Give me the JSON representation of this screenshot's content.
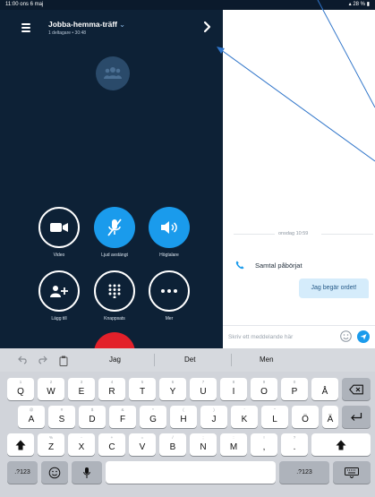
{
  "status_bar": {
    "time_date": "11:00  ons 6 maj",
    "battery": "28 %"
  },
  "call": {
    "title": "Jobba-hemma-träff",
    "title_chevron": "⌄",
    "subtitle": "1 deltagare • 30:48",
    "controls": [
      {
        "id": "video",
        "label": "Video",
        "icon": "video-camera-icon",
        "style": "outline"
      },
      {
        "id": "mute",
        "label": "Ljud avstängt",
        "icon": "microphone-off-icon",
        "style": "blue"
      },
      {
        "id": "speaker",
        "label": "Högtalare",
        "icon": "speaker-icon",
        "style": "blue"
      },
      {
        "id": "add",
        "label": "Lägg till",
        "icon": "add-person-icon",
        "style": "outline"
      },
      {
        "id": "dialpad",
        "label": "Knappsats",
        "icon": "dialpad-icon",
        "style": "outline"
      },
      {
        "id": "more",
        "label": "Mer",
        "icon": "more-icon",
        "style": "outline"
      }
    ]
  },
  "chat": {
    "date": "onsdag 10:59",
    "call_started": "Samtal påbörjat",
    "message": "Jag begär ordet!",
    "compose_placeholder": "Skriv ett meddelande här"
  },
  "keyboard": {
    "suggestions": [
      "Jag",
      "Det",
      "Men"
    ],
    "row1": [
      [
        "Q",
        "1"
      ],
      [
        "W",
        "2"
      ],
      [
        "E",
        "3"
      ],
      [
        "R",
        "4"
      ],
      [
        "T",
        "5"
      ],
      [
        "Y",
        "6"
      ],
      [
        "U",
        "7"
      ],
      [
        "I",
        "8"
      ],
      [
        "O",
        "9"
      ],
      [
        "P",
        "0"
      ],
      [
        "Å",
        ""
      ]
    ],
    "row2": [
      [
        "A",
        "@"
      ],
      [
        "S",
        "#"
      ],
      [
        "D",
        "$"
      ],
      [
        "F",
        "&"
      ],
      [
        "G",
        "*"
      ],
      [
        "H",
        "("
      ],
      [
        "J",
        ")"
      ],
      [
        "K",
        "'"
      ],
      [
        "L",
        "\""
      ],
      [
        "Ö",
        ""
      ],
      [
        "Ä",
        ""
      ]
    ],
    "row3": [
      [
        "Z",
        "%"
      ],
      [
        "X",
        "-"
      ],
      [
        "C",
        "+"
      ],
      [
        "V",
        "="
      ],
      [
        "B",
        "/"
      ],
      [
        "N",
        ";"
      ],
      [
        "M",
        ":"
      ],
      [
        "!",
        ""
      ],
      [
        "?",
        ""
      ]
    ],
    "row3_punct": [
      [
        "!",
        ","
      ],
      [
        "?",
        "."
      ]
    ],
    "numbers_key": ".?123"
  },
  "colors": {
    "call_bg": "#0d2136",
    "accent_blue": "#1a9bec",
    "end_call_red": "#e3202a",
    "bubble_bg": "#d5ecfb",
    "keyboard_bg": "#d1d4da"
  }
}
